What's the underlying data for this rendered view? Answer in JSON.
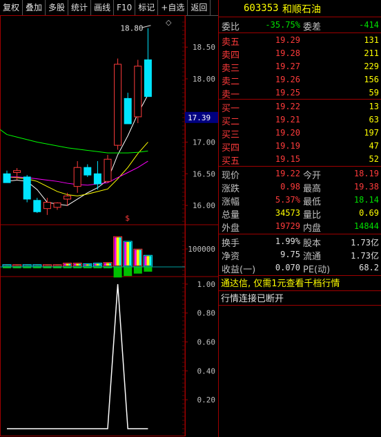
{
  "toolbar": {
    "buttons": [
      "复权",
      "叠加",
      "多股",
      "统计",
      "画线",
      "F10",
      "标记",
      "+自选",
      "返回"
    ]
  },
  "chart": {
    "diamond_icon": "diamond-icon",
    "peak_label": "18.80",
    "price_ticks": [
      "18.50",
      "18.00",
      "17.00",
      "16.50",
      "16.00"
    ],
    "current_price_tag": "17.39",
    "dollar_mark": "$",
    "volume_tick": "100000",
    "osc_ticks": [
      "1.00",
      "0.80",
      "0.60",
      "0.40",
      "0.20"
    ],
    "colors": {
      "up": "#ff3b3b",
      "down": "#00e5ff",
      "ma5": "#ffffff",
      "ma10": "#ffff00",
      "ma20": "#ff00ff",
      "ma60": "#00ff00",
      "grid": "#a00000"
    }
  },
  "chart_data": {
    "type": "candlestick",
    "candles": [
      {
        "open": 16.5,
        "high": 16.55,
        "low": 16.36,
        "close": 16.36
      },
      {
        "open": 16.52,
        "high": 16.59,
        "low": 16.4,
        "close": 16.55
      },
      {
        "open": 16.45,
        "high": 16.48,
        "low": 16.05,
        "close": 16.1
      },
      {
        "open": 16.08,
        "high": 16.12,
        "low": 15.88,
        "close": 15.9
      },
      {
        "open": 15.95,
        "high": 16.12,
        "low": 15.85,
        "close": 16.05
      },
      {
        "open": 15.97,
        "high": 16.05,
        "low": 15.93,
        "close": 16.04
      },
      {
        "open": 16.1,
        "high": 16.2,
        "low": 15.99,
        "close": 16.15
      },
      {
        "open": 16.3,
        "high": 16.7,
        "low": 16.2,
        "close": 16.6
      },
      {
        "open": 16.6,
        "high": 16.65,
        "low": 16.45,
        "close": 16.48
      },
      {
        "open": 16.5,
        "high": 16.7,
        "low": 16.25,
        "close": 16.34
      },
      {
        "open": 16.38,
        "high": 16.8,
        "low": 16.36,
        "close": 16.73
      },
      {
        "open": 16.95,
        "high": 18.32,
        "low": 16.88,
        "close": 18.23
      },
      {
        "open": 17.69,
        "high": 17.78,
        "low": 17.29,
        "close": 17.29
      },
      {
        "open": 17.4,
        "high": 18.3,
        "low": 17.3,
        "close": 18.2
      },
      {
        "open": 18.3,
        "high": 18.8,
        "low": 17.72,
        "close": 17.72
      }
    ],
    "ma_series": [
      {
        "values": [
          16.38,
          16.4,
          16.38,
          16.25,
          16.05,
          16.02,
          16.0,
          16.1,
          16.2,
          16.28,
          16.4,
          16.8,
          17.1,
          17.45,
          17.75
        ]
      },
      {
        "values": [
          16.45,
          16.44,
          16.42,
          16.38,
          16.3,
          16.22,
          16.17,
          16.15,
          16.18,
          16.22,
          16.26,
          16.42,
          16.6,
          16.82,
          17.0
        ]
      },
      {
        "values": [
          16.45,
          16.45,
          16.44,
          16.42,
          16.4,
          16.38,
          16.35,
          16.33,
          16.32,
          16.34,
          16.36,
          16.44,
          16.52,
          16.6,
          16.7
        ]
      },
      {
        "values": [
          17.12,
          17.08,
          17.04,
          17.0,
          16.97,
          16.94,
          16.91,
          16.89,
          16.87,
          16.85,
          16.83,
          16.83,
          16.83,
          16.84,
          16.86
        ]
      }
    ],
    "price_ylim": [
      15.75,
      18.95
    ],
    "volume_relative": [
      0.05,
      0.05,
      0.05,
      0.05,
      0.05,
      0.05,
      0.1,
      0.1,
      0.08,
      0.1,
      0.12,
      0.95,
      0.8,
      0.55,
      0.35
    ],
    "oscillator": [
      0,
      0,
      0,
      0,
      0,
      0,
      0,
      0,
      0,
      0,
      0,
      1.0,
      0,
      0,
      0
    ],
    "osc_ylim": [
      0,
      1.1
    ]
  },
  "quote": {
    "code": "603353",
    "name": "和顺石油",
    "weibi_label": "委比",
    "weibi": "-35.75%",
    "weicha_label": "委差",
    "weicha": "-414",
    "asks": [
      {
        "label": "卖五",
        "price": "19.29",
        "vol": "131"
      },
      {
        "label": "卖四",
        "price": "19.28",
        "vol": "211"
      },
      {
        "label": "卖三",
        "price": "19.27",
        "vol": "229"
      },
      {
        "label": "卖二",
        "price": "19.26",
        "vol": "156"
      },
      {
        "label": "卖一",
        "price": "19.25",
        "vol": "59"
      }
    ],
    "bids": [
      {
        "label": "买一",
        "price": "19.22",
        "vol": "13"
      },
      {
        "label": "买二",
        "price": "19.21",
        "vol": "63"
      },
      {
        "label": "买三",
        "price": "19.20",
        "vol": "197"
      },
      {
        "label": "买四",
        "price": "19.19",
        "vol": "47"
      },
      {
        "label": "买五",
        "price": "19.15",
        "vol": "52"
      }
    ],
    "stats": [
      {
        "l1": "现价",
        "v1": "19.22",
        "l2": "今开",
        "v2": "18.19",
        "c1": "red",
        "c2": "red"
      },
      {
        "l1": "涨跌",
        "v1": "0.98",
        "l2": "最高",
        "v2": "19.38",
        "c1": "red",
        "c2": "red"
      },
      {
        "l1": "涨幅",
        "v1": "5.37%",
        "l2": "最低",
        "v2": "18.14",
        "c1": "red",
        "c2": "green"
      },
      {
        "l1": "总量",
        "v1": "34573",
        "l2": "量比",
        "v2": "0.69",
        "c1": "yellow",
        "c2": "yellow"
      },
      {
        "l1": "外盘",
        "v1": "19729",
        "l2": "内盘",
        "v2": "14844",
        "c1": "red",
        "c2": "green"
      }
    ],
    "fin": [
      {
        "l1": "换手",
        "v1": "1.99%",
        "l2": "股本",
        "v2": "1.73亿"
      },
      {
        "l1": "净资",
        "v1": "9.75",
        "l2": "流通",
        "v2": "1.73亿"
      },
      {
        "l1": "收益(一)",
        "v1": "0.070",
        "l2": "PE(动)",
        "v2": "68.2"
      }
    ],
    "notice1": "通达信, 仅需1元查看千档行情",
    "notice2": "行情连接已断开"
  }
}
